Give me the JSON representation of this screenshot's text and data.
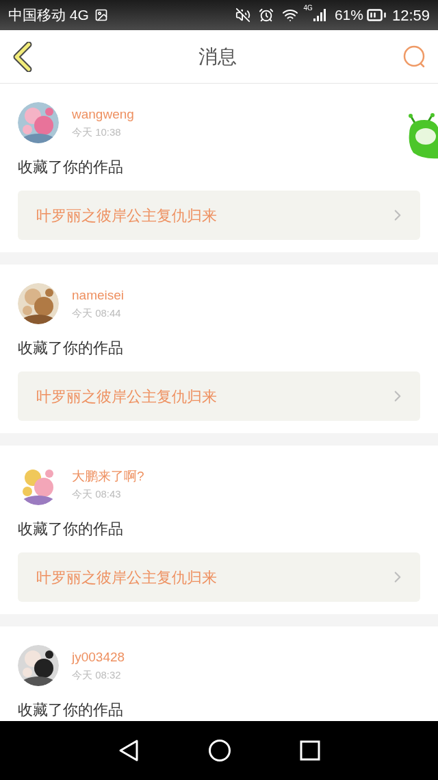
{
  "status_bar": {
    "carrier": "中国移动 4G",
    "network": "4G",
    "battery": "61%",
    "time": "12:59"
  },
  "header": {
    "title": "消息"
  },
  "messages": [
    {
      "user": "wangweng",
      "time": "今天 10:38",
      "action": "收藏了你的作品",
      "work": "叶罗丽之彼岸公主复仇归来"
    },
    {
      "user": "nameisei",
      "time": "今天 08:44",
      "action": "收藏了你的作品",
      "work": "叶罗丽之彼岸公主复仇归来"
    },
    {
      "user": "大鹏来了啊?",
      "time": "今天 08:43",
      "action": "收藏了你的作品",
      "work": "叶罗丽之彼岸公主复仇归来"
    },
    {
      "user": "jy003428",
      "time": "今天 08:32",
      "action": "收藏了你的作品"
    }
  ]
}
